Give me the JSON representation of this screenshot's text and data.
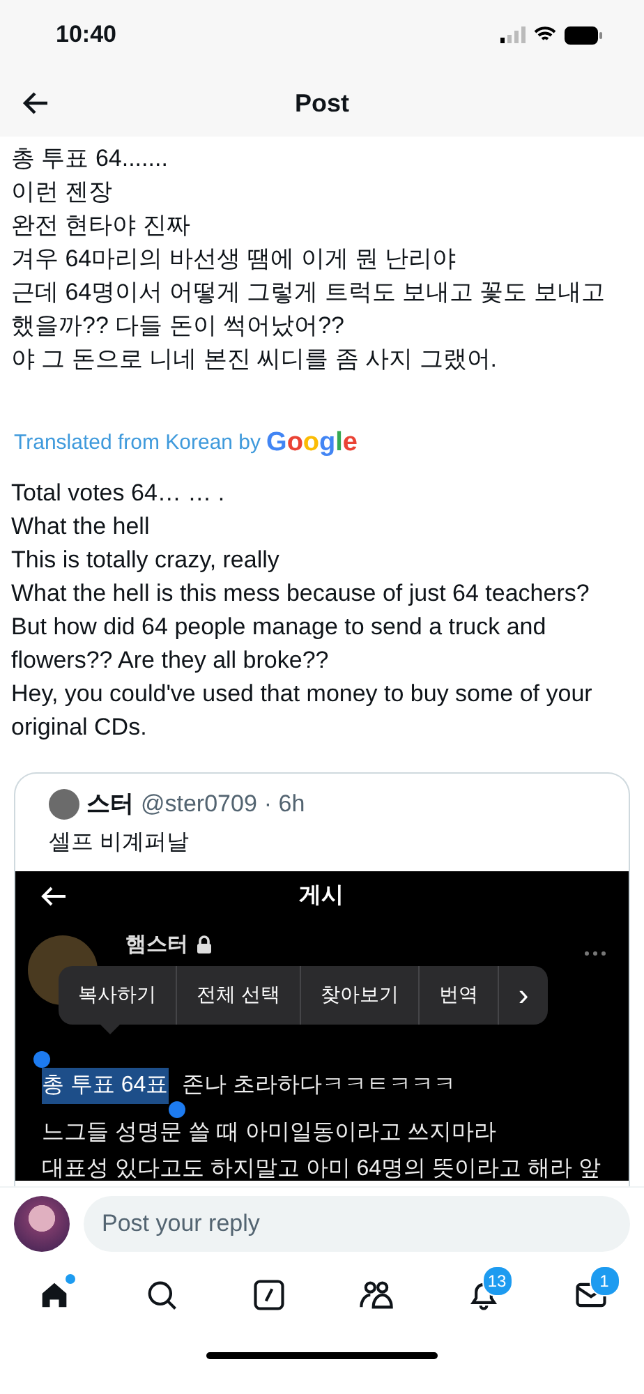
{
  "status_bar": {
    "time": "10:40"
  },
  "header": {
    "title": "Post"
  },
  "post": {
    "korean_lines": [
      "총 투표 64.......",
      "이런 젠장",
      "완전 현타야 진짜",
      "겨우 64마리의 바선생 땜에 이게 뭔 난리야",
      "근데 64명이서 어떻게 그렇게 트럭도 보내고 꽃도 보내고 했을까?? 다들 돈이 썩어났어??",
      "야 그 돈으로 니네 본진 씨디를 좀 사지 그랬어."
    ],
    "translation_label": "Translated from Korean by",
    "translation_brand": "Google",
    "english_lines": [
      "Total votes 64… … .",
      "What the hell",
      "This is totally crazy, really",
      "What the hell is this mess because of just 64 teachers?",
      "But how did 64 people manage to send a truck and flowers?? Are they all broke??",
      "Hey, you could've used that money to buy some of your original CDs."
    ]
  },
  "quote": {
    "name": "스터",
    "handle": "@ster0709",
    "time": "· 6h",
    "text": "셀프 비계퍼날",
    "screenshot": {
      "title": "게시",
      "author": "햄스터",
      "locked": true,
      "menu": [
        "복사하기",
        "전체 선택",
        "찾아보기",
        "번역",
        "›"
      ],
      "selected_text": "총 투표 64표",
      "first_line_rest": " 존나 초라하다ㅋㅋㅌㅋㅋㅋ",
      "lines": [
        "느그들 성명문 쓸 때 아미일동이라고 쓰지마라",
        "대표성 있다고도 하지말고 아미 64명의 뜻이라고 해라 앞"
      ]
    }
  },
  "reply": {
    "placeholder": "Post your reply"
  },
  "tabs": [
    {
      "kind": "home",
      "selected": true,
      "dot": true
    },
    {
      "kind": "search",
      "selected": false,
      "dot": false
    },
    {
      "kind": "compose",
      "selected": false,
      "dot": false
    },
    {
      "kind": "people",
      "selected": false,
      "dot": false
    },
    {
      "kind": "bell",
      "selected": false,
      "dot": false,
      "badge": "13"
    },
    {
      "kind": "mail",
      "selected": false,
      "dot": false,
      "badge": "1"
    }
  ]
}
